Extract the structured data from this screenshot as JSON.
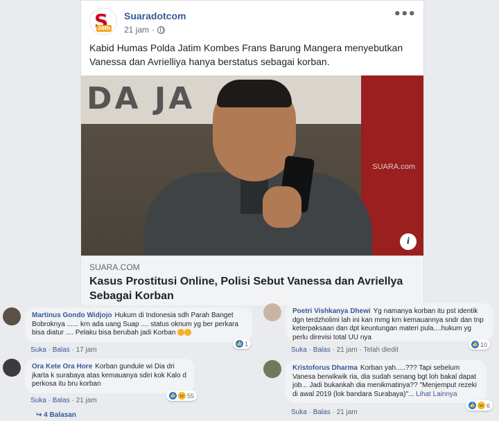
{
  "post": {
    "page_name": "Suaradotcom",
    "time": "21 jam",
    "avatar_letter": "S",
    "avatar_year": "20th",
    "caption": "Kabid Humas Polda Jatim Kombes Frans Barung Mangera menyebutkan Vanessa dan Avrielliya hanya berstatus sebagai korban.",
    "photo_wall_text": "DA JA",
    "photo_watermark": "SUARA.com",
    "link_domain": "SUARA.COM",
    "link_title": "Kasus Prostitusi Online, Polisi Sebut Vanessa dan Avriellya Sebagai Korban"
  },
  "comments_left": [
    {
      "name": "Martinus Gondo Widjojo",
      "text": "Hukum di Indonesia sdh Parah Banget Bobroknya ...... krn ada uang Suap .... status oknum yg ber perkara bisa diatur .... Pelaku bisa berubah jadi Korban",
      "like": "Suka",
      "reply": "Balas",
      "time": "17 jam",
      "reactions": "1"
    },
    {
      "name": "Ora Kete Ora Hore",
      "text": "Korban gundule wi Dia dri jkarta k surabaya atas kemauanya sdiri kok Kalo d perkosa itu bru korban",
      "like": "Suka",
      "reply": "Balas",
      "time": "21 jam",
      "reactions": "55",
      "replies_label": "4 Balasan"
    }
  ],
  "comments_right": [
    {
      "name": "Poetri Vishkanya Dhewi",
      "text": "Yg namanya korban itu pst identik dgn terdzholimi lah ini kan mmg krn kemauannya sndr dan tnp keterpaksaan dan dpt keuntungan materi pula....hukum yg perlu direvisi total UU nya",
      "like": "Suka",
      "reply": "Balas",
      "time": "21 jam",
      "edited": "Telah diedit",
      "reactions": "10"
    },
    {
      "name": "Kristoforus Dharma",
      "text": "Korban yah.....??? Tapi sebelum Vanesa berwikwik ria, dia sudah senang bgt loh bakal dapat job... Jadi bukankah dia menikmatinya?? \"Menjemput rezeki di awal 2019 (lok bandara Surabaya)\"...",
      "see_more": "Lihat Lainnya",
      "like": "Suka",
      "reply": "Balas",
      "time": "21 jam",
      "reactions": "6"
    }
  ],
  "colors": {
    "link_blue": "#385898",
    "meta_gray": "#606770",
    "bubble_gray": "#f2f3f5",
    "like_blue": "#1877f2",
    "haha_yellow": "#f7b125"
  }
}
